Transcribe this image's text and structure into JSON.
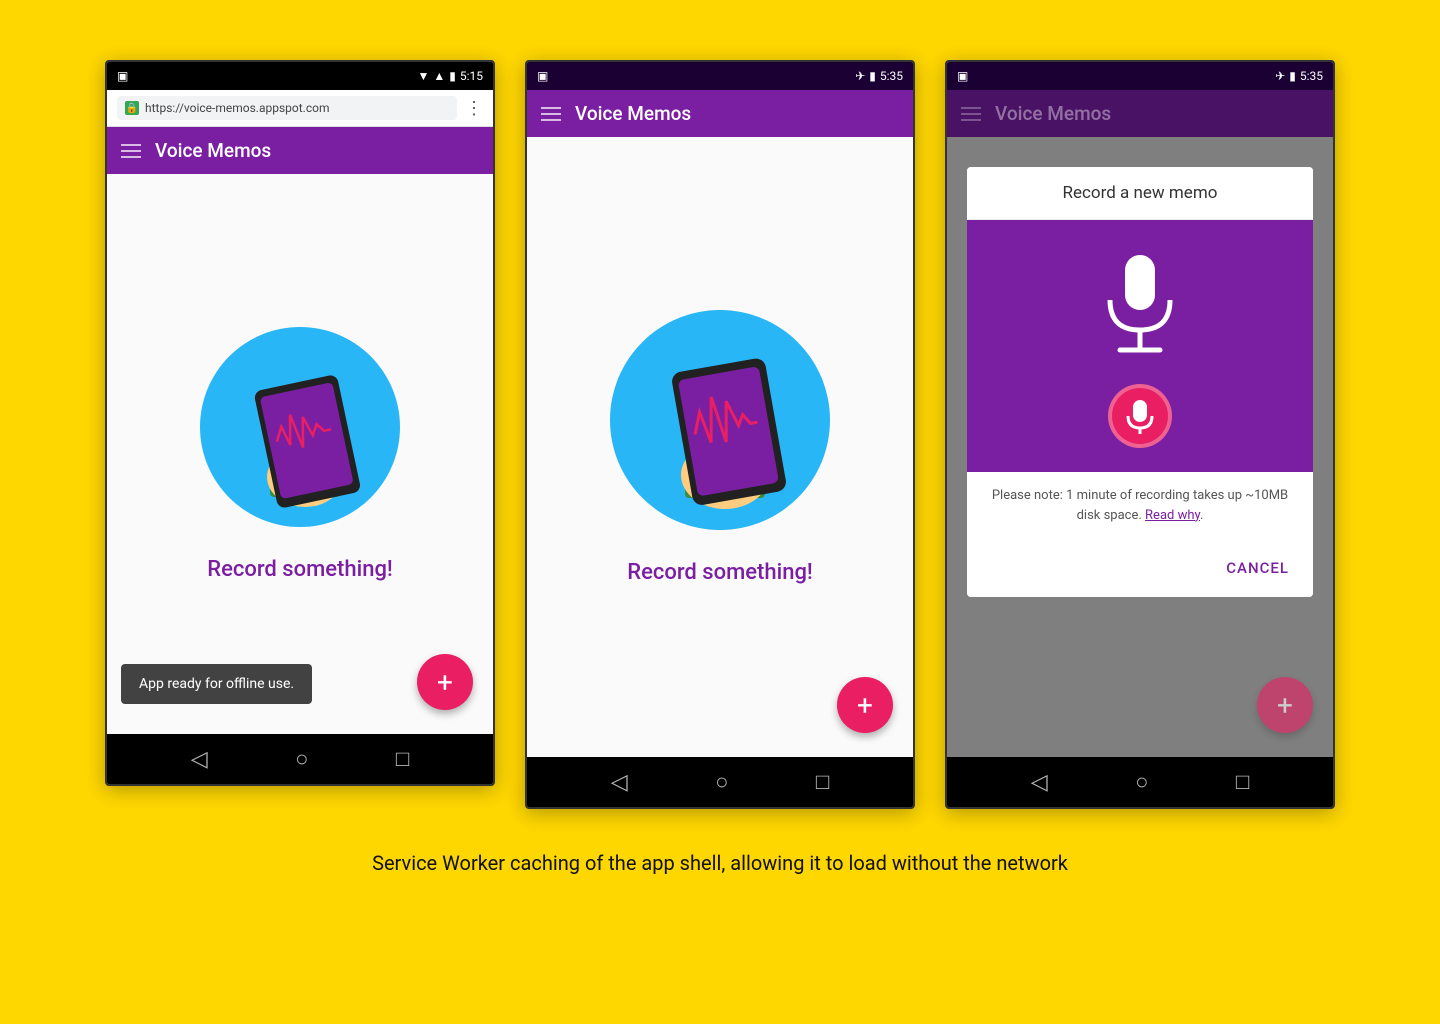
{
  "page": {
    "background": "#FFD700",
    "caption": "Service Worker caching of the app shell, allowing it to load without the network"
  },
  "phone1": {
    "status": {
      "time": "5:15",
      "icons": [
        "wifi",
        "signal",
        "battery"
      ]
    },
    "address_bar": {
      "url": "https://voice-memos.appspot.com",
      "menu_icon": "⋮"
    },
    "toolbar": {
      "title": "Voice Memos"
    },
    "content": {
      "record_label": "Record something!"
    },
    "toast": "App ready for offline use.",
    "fab_label": "+",
    "nav": [
      "◁",
      "○",
      "□"
    ]
  },
  "phone2": {
    "status": {
      "time": "5:35",
      "icons": [
        "airplane",
        "battery"
      ]
    },
    "toolbar": {
      "title": "Voice Memos"
    },
    "content": {
      "record_label": "Record something!"
    },
    "fab_label": "+",
    "nav": [
      "◁",
      "○",
      "□"
    ]
  },
  "phone3": {
    "status": {
      "time": "5:35",
      "icons": [
        "airplane",
        "battery"
      ]
    },
    "toolbar": {
      "title": "Voice Memos"
    },
    "dialog": {
      "title": "Record a new memo",
      "note": "Please note: 1 minute of recording takes up ~10MB disk space.",
      "note_link": "Read why",
      "cancel_label": "CANCEL"
    },
    "fab_label": "+",
    "nav": [
      "◁",
      "○",
      "□"
    ]
  }
}
